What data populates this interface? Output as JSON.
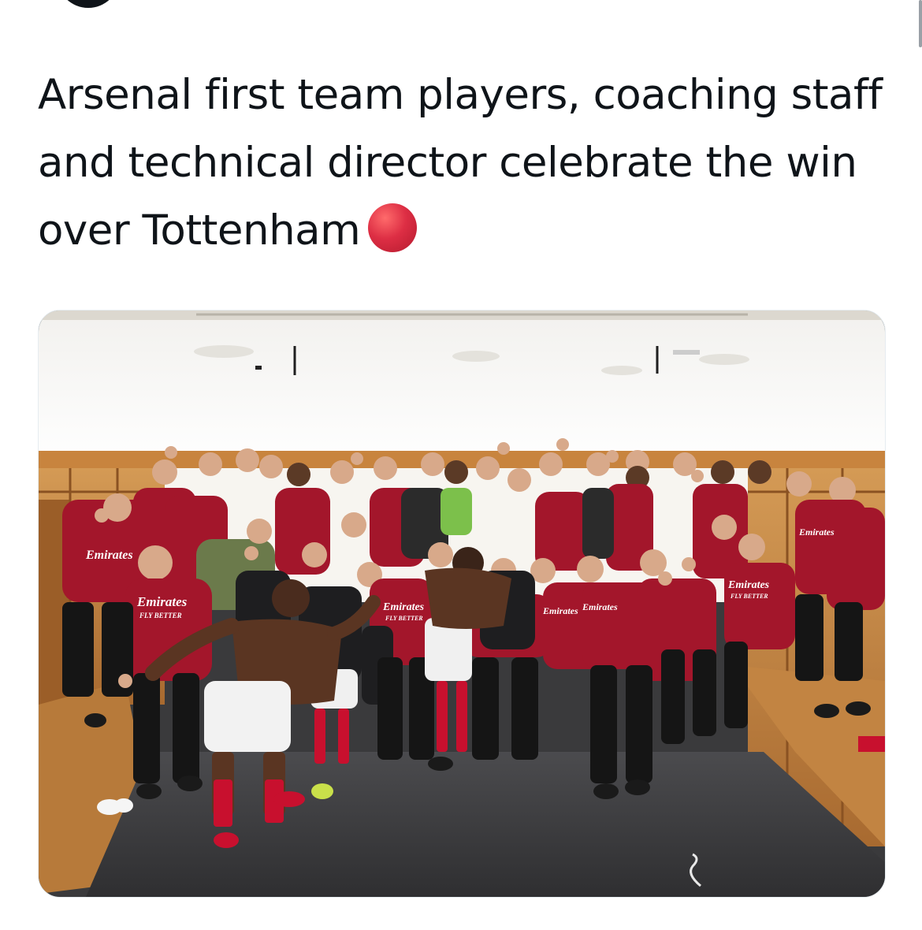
{
  "tweet": {
    "text": "Arsenal first team players, coaching staff and technical director celebrate the win over Tottenham",
    "emoji": "red-circle",
    "photo": {
      "jersey_sponsor": "Emirates",
      "jersey_tagline": "FLY BETTER"
    }
  },
  "colors": {
    "text": "#0f1419",
    "emoji": "#dd2e44",
    "jersey": "#a3162b"
  }
}
